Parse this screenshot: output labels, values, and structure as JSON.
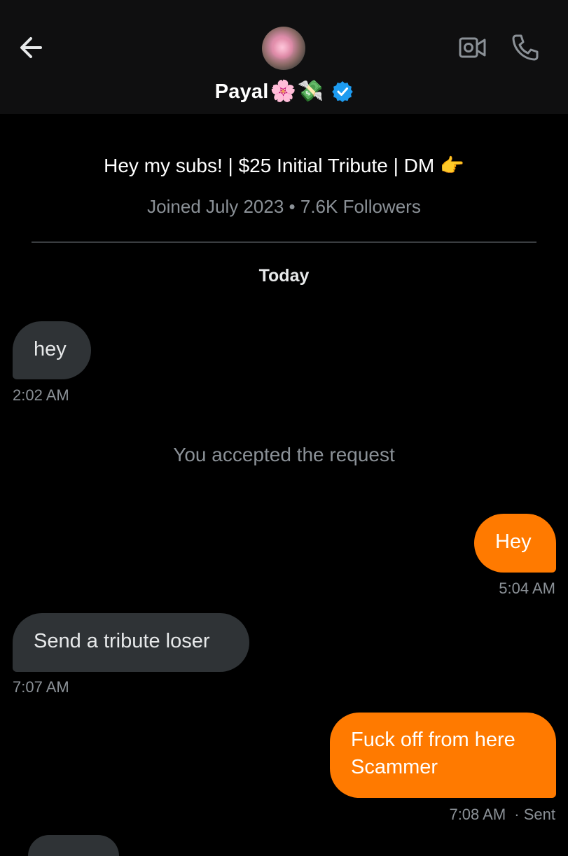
{
  "header": {
    "name": "Payal",
    "name_emojis": [
      "🌸",
      "💸"
    ],
    "verified": true,
    "icons": [
      "back-arrow-icon",
      "video-call-icon",
      "phone-icon",
      "verified-badge-icon"
    ]
  },
  "profile": {
    "bio": "Hey my subs! | $25 Initial Tribute | DM 👉",
    "meta": "Joined July 2023 • 7.6K Followers"
  },
  "conversation": {
    "day_label": "Today",
    "system_message": "You accepted the request",
    "messages": [
      {
        "direction": "in",
        "text": "hey",
        "time": "2:02 AM"
      },
      {
        "direction": "out",
        "text": "Hey",
        "time": "5:04 AM"
      },
      {
        "direction": "in",
        "text": "Send a tribute loser",
        "time": "7:07 AM"
      },
      {
        "direction": "out",
        "text": "Fuck off from here Scammer",
        "time": "7:08 AM",
        "status": "· Sent"
      }
    ]
  },
  "colors": {
    "background": "#000000",
    "header_bg": "#0f0f10",
    "incoming_bubble": "#2f3336",
    "outgoing_bubble": "#ff7a00",
    "verified_blue": "#1d9bf0",
    "muted_text": "#8b9197"
  }
}
